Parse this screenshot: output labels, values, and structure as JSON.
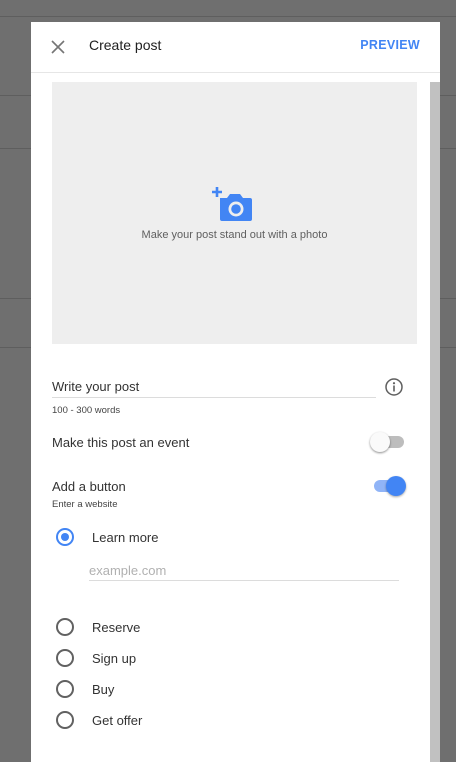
{
  "dialog": {
    "title": "Create post",
    "preview_label": "PREVIEW",
    "close_icon": "close-icon"
  },
  "photo": {
    "icon": "add-photo-icon",
    "text": "Make your post stand out with a photo",
    "icon_color": "#4285f4"
  },
  "post": {
    "label": "Write your post",
    "hint": "100 - 300 words",
    "info_icon": "info-icon"
  },
  "event": {
    "label": "Make this post an event",
    "enabled": false
  },
  "button": {
    "label": "Add a button",
    "hint": "Enter a website",
    "enabled": true
  },
  "options": [
    {
      "label": "Learn more",
      "checked": true
    },
    {
      "label": "Reserve",
      "checked": false
    },
    {
      "label": "Sign up",
      "checked": false
    },
    {
      "label": "Buy",
      "checked": false
    },
    {
      "label": "Get offer",
      "checked": false
    }
  ],
  "url_input": {
    "placeholder": "example.com",
    "value": ""
  },
  "colors": {
    "accent": "#4285f4",
    "overlay": "#6f6f6f"
  }
}
